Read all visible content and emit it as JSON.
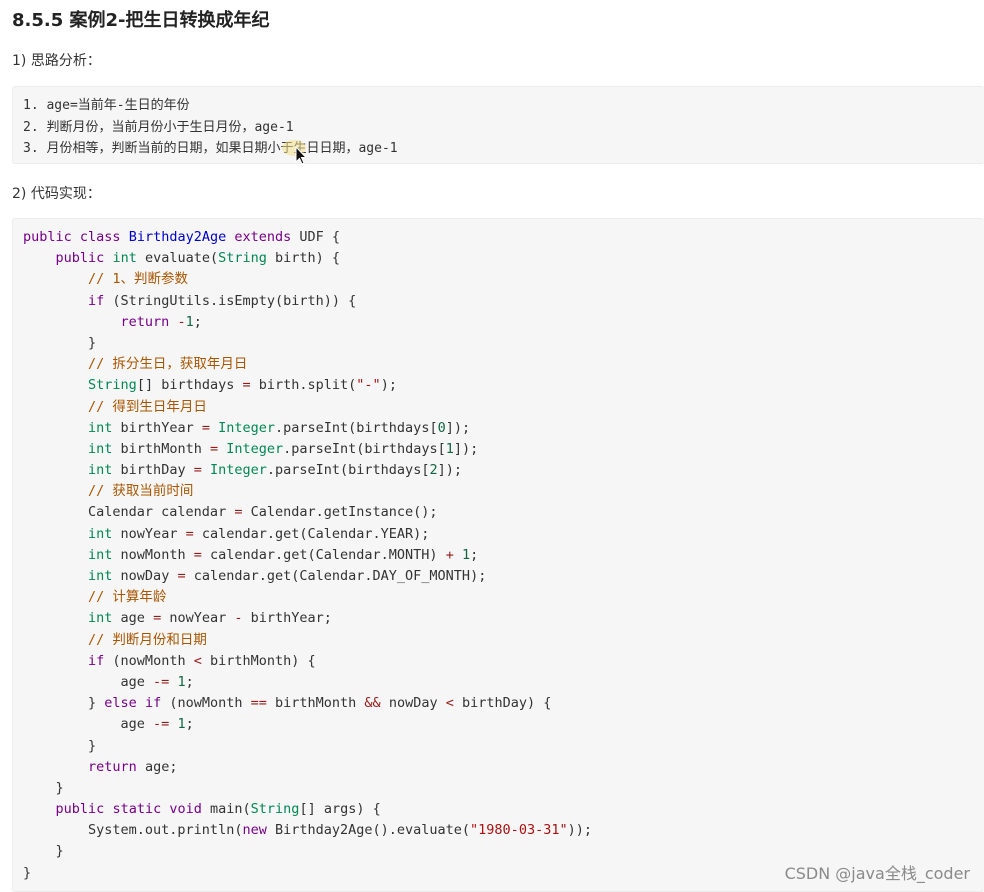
{
  "heading": "8.5.5 案例2-把生日转换成年纪",
  "section1_title": "1) 思路分析：",
  "section2_title": "2) 代码实现：",
  "steps": [
    "1. age=当前年-生日的年份",
    "2. 判断月份，当前月份小于生日月份，age-1",
    "3. 月份相等，判断当前的日期，如果日期小于生日日期，age-1"
  ],
  "code": [
    [
      [
        "kw",
        "public"
      ],
      [
        "p",
        " "
      ],
      [
        "kw",
        "class"
      ],
      [
        "p",
        " "
      ],
      [
        "cls",
        "Birthday2Age"
      ],
      [
        "p",
        " "
      ],
      [
        "kw",
        "extends"
      ],
      [
        "p",
        " UDF {"
      ]
    ],
    [
      [
        "p",
        "    "
      ],
      [
        "kw",
        "public"
      ],
      [
        "p",
        " "
      ],
      [
        "ty",
        "int"
      ],
      [
        "p",
        " evaluate("
      ],
      [
        "ty",
        "String"
      ],
      [
        "p",
        " birth) {"
      ]
    ],
    [
      [
        "p",
        "        "
      ],
      [
        "cm",
        "// 1、判断参数"
      ]
    ],
    [
      [
        "p",
        "        "
      ],
      [
        "kw",
        "if"
      ],
      [
        "p",
        " (StringUtils.isEmpty(birth)) {"
      ]
    ],
    [
      [
        "p",
        "            "
      ],
      [
        "kw",
        "return"
      ],
      [
        "p",
        " "
      ],
      [
        "op",
        "-"
      ],
      [
        "nm",
        "1"
      ],
      [
        "p",
        ";"
      ]
    ],
    [
      [
        "p",
        "        }"
      ]
    ],
    [
      [
        "p",
        "        "
      ],
      [
        "cm",
        "// 拆分生日，获取年月日"
      ]
    ],
    [
      [
        "p",
        "        "
      ],
      [
        "ty",
        "String"
      ],
      [
        "p",
        "[] birthdays "
      ],
      [
        "op",
        "="
      ],
      [
        "p",
        " birth.split("
      ],
      [
        "st",
        "\"-\""
      ],
      [
        "p",
        ");"
      ]
    ],
    [
      [
        "p",
        "        "
      ],
      [
        "cm",
        "// 得到生日年月日"
      ]
    ],
    [
      [
        "p",
        "        "
      ],
      [
        "ty",
        "int"
      ],
      [
        "p",
        " birthYear "
      ],
      [
        "op",
        "="
      ],
      [
        "p",
        " "
      ],
      [
        "ty",
        "Integer"
      ],
      [
        "p",
        ".parseInt(birthdays["
      ],
      [
        "nm",
        "0"
      ],
      [
        "p",
        "]);"
      ]
    ],
    [
      [
        "p",
        "        "
      ],
      [
        "ty",
        "int"
      ],
      [
        "p",
        " birthMonth "
      ],
      [
        "op",
        "="
      ],
      [
        "p",
        " "
      ],
      [
        "ty",
        "Integer"
      ],
      [
        "p",
        ".parseInt(birthdays["
      ],
      [
        "nm",
        "1"
      ],
      [
        "p",
        "]);"
      ]
    ],
    [
      [
        "p",
        "        "
      ],
      [
        "ty",
        "int"
      ],
      [
        "p",
        " birthDay "
      ],
      [
        "op",
        "="
      ],
      [
        "p",
        " "
      ],
      [
        "ty",
        "Integer"
      ],
      [
        "p",
        ".parseInt(birthdays["
      ],
      [
        "nm",
        "2"
      ],
      [
        "p",
        "]);"
      ]
    ],
    [
      [
        "p",
        "        "
      ],
      [
        "cm",
        "// 获取当前时间"
      ]
    ],
    [
      [
        "p",
        "        Calendar calendar "
      ],
      [
        "op",
        "="
      ],
      [
        "p",
        " Calendar.getInstance();"
      ]
    ],
    [
      [
        "p",
        "        "
      ],
      [
        "ty",
        "int"
      ],
      [
        "p",
        " nowYear "
      ],
      [
        "op",
        "="
      ],
      [
        "p",
        " calendar.get(Calendar.YEAR);"
      ]
    ],
    [
      [
        "p",
        "        "
      ],
      [
        "ty",
        "int"
      ],
      [
        "p",
        " nowMonth "
      ],
      [
        "op",
        "="
      ],
      [
        "p",
        " calendar.get(Calendar.MONTH) "
      ],
      [
        "op",
        "+"
      ],
      [
        "p",
        " "
      ],
      [
        "nm",
        "1"
      ],
      [
        "p",
        ";"
      ]
    ],
    [
      [
        "p",
        "        "
      ],
      [
        "ty",
        "int"
      ],
      [
        "p",
        " nowDay "
      ],
      [
        "op",
        "="
      ],
      [
        "p",
        " calendar.get(Calendar.DAY_OF_MONTH);"
      ]
    ],
    [
      [
        "p",
        "        "
      ],
      [
        "cm",
        "// 计算年龄"
      ]
    ],
    [
      [
        "p",
        "        "
      ],
      [
        "ty",
        "int"
      ],
      [
        "p",
        " age "
      ],
      [
        "op",
        "="
      ],
      [
        "p",
        " nowYear "
      ],
      [
        "op",
        "-"
      ],
      [
        "p",
        " birthYear;"
      ]
    ],
    [
      [
        "p",
        "        "
      ],
      [
        "cm",
        "// 判断月份和日期"
      ]
    ],
    [
      [
        "p",
        "        "
      ],
      [
        "kw",
        "if"
      ],
      [
        "p",
        " (nowMonth "
      ],
      [
        "op",
        "<"
      ],
      [
        "p",
        " birthMonth) {"
      ]
    ],
    [
      [
        "p",
        "            age "
      ],
      [
        "op",
        "-="
      ],
      [
        "p",
        " "
      ],
      [
        "nm",
        "1"
      ],
      [
        "p",
        ";"
      ]
    ],
    [
      [
        "p",
        "        } "
      ],
      [
        "kw",
        "else"
      ],
      [
        "p",
        " "
      ],
      [
        "kw",
        "if"
      ],
      [
        "p",
        " (nowMonth "
      ],
      [
        "op",
        "=="
      ],
      [
        "p",
        " birthMonth "
      ],
      [
        "op",
        "&&"
      ],
      [
        "p",
        " nowDay "
      ],
      [
        "op",
        "<"
      ],
      [
        "p",
        " birthDay) {"
      ]
    ],
    [
      [
        "p",
        "            age "
      ],
      [
        "op",
        "-="
      ],
      [
        "p",
        " "
      ],
      [
        "nm",
        "1"
      ],
      [
        "p",
        ";"
      ]
    ],
    [
      [
        "p",
        "        }"
      ]
    ],
    [
      [
        "p",
        "        "
      ],
      [
        "kw",
        "return"
      ],
      [
        "p",
        " age;"
      ]
    ],
    [
      [
        "p",
        "    }"
      ]
    ],
    [
      [
        "p",
        "    "
      ],
      [
        "kw",
        "public"
      ],
      [
        "p",
        " "
      ],
      [
        "kw",
        "static"
      ],
      [
        "p",
        " "
      ],
      [
        "kw",
        "void"
      ],
      [
        "p",
        " main("
      ],
      [
        "ty",
        "String"
      ],
      [
        "p",
        "[] args) {"
      ]
    ],
    [
      [
        "p",
        "        System.out.println("
      ],
      [
        "kw",
        "new"
      ],
      [
        "p",
        " Birthday2Age().evaluate("
      ],
      [
        "st",
        "\"1980-03-31\""
      ],
      [
        "p",
        "));"
      ]
    ],
    [
      [
        "p",
        "    }"
      ]
    ],
    [
      [
        "p",
        "}"
      ]
    ]
  ],
  "watermark": "CSDN @java全栈_coder"
}
